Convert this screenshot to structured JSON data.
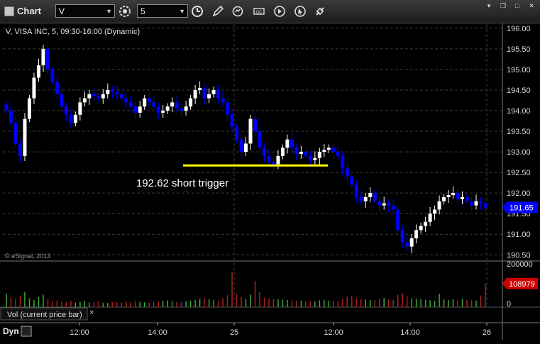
{
  "window": {
    "title": "Chart",
    "symbol_value": "V",
    "interval_value": "5",
    "toolbar_icons": [
      "settings-icon",
      "clock-icon",
      "pencil-icon",
      "refresh-icon",
      "gc-icon",
      "play-icon",
      "cursor-icon",
      "link-icon"
    ],
    "window_controls": [
      "menu",
      "restore",
      "maximize",
      "close"
    ]
  },
  "chart_data": {
    "type": "candlestick",
    "header": "V, VISA INC, 5, 09:30-16:00 (Dynamic)",
    "watermark": "© eSignal, 2013",
    "ylim": [
      190.35,
      196.1
    ],
    "yticks": [
      "196.00",
      "195.50",
      "195.00",
      "194.50",
      "194.00",
      "193.50",
      "193.00",
      "192.50",
      "192.00",
      "191.50",
      "191.00",
      "190.50"
    ],
    "xticks": [
      "12:00",
      "14:00",
      "25",
      "12:00",
      "14:00",
      "26"
    ],
    "last_price": "191.65",
    "annotation": {
      "text": "192.62 short trigger",
      "level": 192.67,
      "color": "#ffff00"
    },
    "colors": {
      "up": "#ffffff",
      "down": "#0000ff",
      "price_tag": "#0000ff",
      "volume_tag": "#cc0000"
    },
    "closes": [
      194.0,
      193.7,
      193.2,
      192.9,
      193.8,
      194.3,
      194.8,
      195.1,
      195.5,
      195.0,
      194.7,
      194.4,
      194.1,
      193.9,
      193.7,
      193.9,
      194.2,
      194.3,
      194.4,
      194.35,
      194.3,
      194.4,
      194.5,
      194.45,
      194.4,
      194.3,
      194.2,
      194.1,
      193.95,
      194.1,
      194.3,
      194.2,
      194.1,
      193.95,
      194.0,
      194.1,
      194.2,
      194.05,
      194.0,
      194.1,
      194.3,
      194.5,
      194.55,
      194.3,
      194.4,
      194.5,
      194.3,
      194.2,
      193.9,
      193.6,
      193.3,
      193.0,
      193.2,
      193.8,
      193.5,
      193.1,
      192.9,
      192.75,
      192.7,
      192.9,
      193.1,
      193.3,
      193.1,
      192.95,
      193.0,
      192.9,
      192.8,
      192.85,
      193.0,
      193.05,
      193.1,
      193.0,
      192.9,
      192.6,
      192.4,
      192.2,
      191.9,
      191.8,
      191.9,
      192.0,
      191.8,
      191.7,
      191.75,
      191.7,
      191.6,
      191.1,
      190.8,
      190.7,
      190.9,
      191.1,
      191.2,
      191.3,
      191.5,
      191.6,
      191.8,
      191.9,
      191.95,
      192.0,
      191.85,
      191.9,
      191.8,
      191.7,
      191.8,
      191.75,
      191.65
    ],
    "volume": {
      "ylim": [
        0,
        200000
      ],
      "yticks": [
        "200000",
        "100000",
        "0"
      ],
      "last": "108979",
      "label": "Vol (current price bar)",
      "values": [
        62000,
        45000,
        38000,
        52000,
        70000,
        41000,
        33000,
        47000,
        58000,
        36000,
        29000,
        31000,
        26000,
        24000,
        28000,
        22000,
        25000,
        30000,
        21000,
        23000,
        27000,
        20000,
        19000,
        24000,
        22000,
        21000,
        26000,
        23000,
        28000,
        25000,
        22000,
        20000,
        24000,
        27000,
        29000,
        31000,
        26000,
        23000,
        25000,
        28000,
        30000,
        33000,
        38000,
        40000,
        36000,
        34000,
        29000,
        41000,
        55000,
        160000,
        62000,
        48000,
        37000,
        58000,
        120000,
        70000,
        44000,
        40000,
        38000,
        36000,
        35000,
        33000,
        31000,
        29000,
        30000,
        28000,
        27000,
        26000,
        32000,
        34000,
        30000,
        28000,
        26000,
        36000,
        48000,
        52000,
        41000,
        37000,
        35000,
        33000,
        31000,
        38000,
        42000,
        36000,
        33000,
        57000,
        64000,
        49000,
        40000,
        38000,
        36000,
        34000,
        32000,
        30000,
        62000,
        35000,
        33000,
        36000,
        31000,
        39000,
        34000,
        32000,
        30000,
        54000,
        108979
      ]
    }
  },
  "footer": {
    "mode": "Dyn"
  }
}
